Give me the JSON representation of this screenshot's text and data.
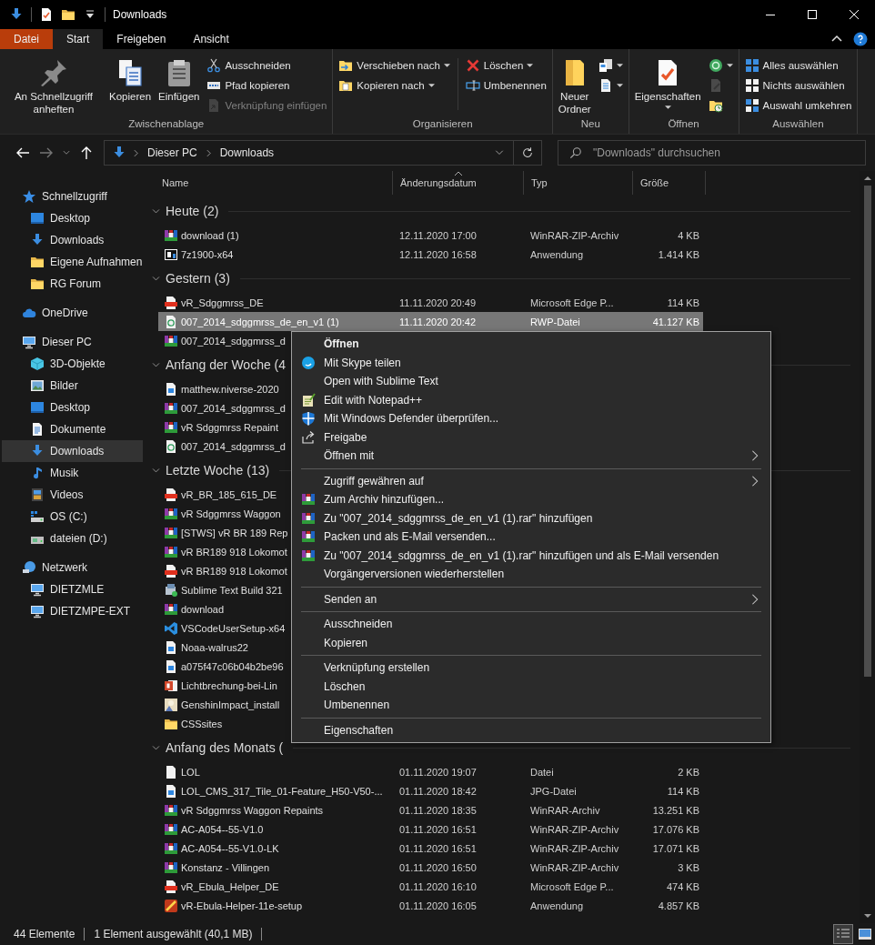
{
  "window": {
    "title": "Downloads"
  },
  "ribbon": {
    "tabs": [
      {
        "label": "Datei",
        "kind": "backstage",
        "selected": false
      },
      {
        "label": "Start",
        "kind": "tab",
        "selected": true
      },
      {
        "label": "Freigeben",
        "kind": "tab",
        "selected": false
      },
      {
        "label": "Ansicht",
        "kind": "tab",
        "selected": false
      }
    ],
    "groups": [
      {
        "title": "Zwischenablage",
        "columns": [
          {
            "kind": "large",
            "items": [
              {
                "label": "An Schnellzugriff anheften",
                "kind": "pin",
                "dropdown": false,
                "disabled": false
              }
            ]
          },
          {
            "kind": "large",
            "items": [
              {
                "label": "Kopieren",
                "kind": "copy",
                "dropdown": false,
                "disabled": false
              }
            ]
          },
          {
            "kind": "large",
            "items": [
              {
                "label": "Einfügen",
                "kind": "paste",
                "dropdown": false,
                "disabled": false
              }
            ]
          },
          {
            "kind": "stack",
            "items": [
              {
                "label": "Ausschneiden",
                "kind": "scissors",
                "dropdown": false,
                "disabled": false
              },
              {
                "label": "Pfad kopieren",
                "kind": "path",
                "dropdown": false,
                "disabled": false
              },
              {
                "label": "Verknüpfung einfügen",
                "kind": "shortcut",
                "dropdown": false,
                "disabled": true
              }
            ]
          }
        ]
      },
      {
        "title": "Organisieren",
        "columns": [
          {
            "kind": "stack",
            "items": [
              {
                "label": "Verschieben nach",
                "kind": "move",
                "dropdown": true,
                "disabled": false
              },
              {
                "label": "Kopieren nach",
                "kind": "copyto",
                "dropdown": true,
                "disabled": false
              }
            ]
          },
          {
            "kind": "stack",
            "items": [
              {
                "label": "Löschen",
                "kind": "delete",
                "dropdown": true,
                "disabled": false
              },
              {
                "label": "Umbenennen",
                "kind": "rename",
                "dropdown": false,
                "disabled": false
              }
            ]
          }
        ]
      },
      {
        "title": "Neu",
        "columns": [
          {
            "kind": "large",
            "items": [
              {
                "label": "Neuer Ordner",
                "kind": "newfolder",
                "dropdown": false,
                "disabled": false
              }
            ]
          },
          {
            "kind": "stack",
            "items": [
              {
                "kind": "newitem",
                "dropdown": true,
                "disabled": false
              },
              {
                "kind": "easyaccess",
                "dropdown": true,
                "disabled": false
              }
            ]
          }
        ]
      },
      {
        "title": "Öffnen",
        "columns": [
          {
            "kind": "large",
            "items": [
              {
                "label": "Eigenschaften",
                "kind": "properties",
                "dropdown": true,
                "disabled": false
              }
            ]
          },
          {
            "kind": "stack",
            "items": [
              {
                "kind": "open",
                "dropdown": true,
                "disabled": false
              },
              {
                "kind": "edit",
                "dropdown": false,
                "disabled": true
              },
              {
                "kind": "history",
                "dropdown": false,
                "disabled": false
              }
            ]
          }
        ]
      },
      {
        "title": "Auswählen",
        "columns": [
          {
            "kind": "stack",
            "items": [
              {
                "label": "Alles auswählen",
                "kind": "selectall",
                "dropdown": false,
                "disabled": false
              },
              {
                "label": "Nichts auswählen",
                "kind": "selectnone",
                "dropdown": false,
                "disabled": false
              },
              {
                "label": "Auswahl umkehren",
                "kind": "invert",
                "dropdown": false,
                "disabled": false
              }
            ]
          }
        ]
      }
    ]
  },
  "navigation": {
    "back": {
      "disabled": false
    },
    "forward": {
      "disabled": true
    }
  },
  "address": {
    "crumbs": [
      "Dieser PC",
      "Downloads"
    ]
  },
  "search": {
    "placeholder": "\"Downloads\" durchsuchen"
  },
  "sidebar": {
    "items": [
      {
        "label": "Schnellzugriff",
        "kind": "star",
        "selected": false,
        "children": [
          {
            "label": "Desktop",
            "kind": "desktop",
            "selected": false
          },
          {
            "label": "Downloads",
            "kind": "download",
            "selected": false
          },
          {
            "label": "Eigene Aufnahmen",
            "kind": "folder",
            "selected": false
          },
          {
            "label": "RG Forum",
            "kind": "folder",
            "selected": false
          }
        ]
      },
      {
        "label": "OneDrive",
        "kind": "cloud",
        "selected": false
      },
      {
        "label": "Dieser PC",
        "kind": "pc",
        "selected": false,
        "children": [
          {
            "label": "3D-Objekte",
            "kind": "cube",
            "selected": false
          },
          {
            "label": "Bilder",
            "kind": "pictures",
            "selected": false
          },
          {
            "label": "Desktop",
            "kind": "desktop",
            "selected": false
          },
          {
            "label": "Dokumente",
            "kind": "documents",
            "selected": false
          },
          {
            "label": "Downloads",
            "kind": "download",
            "selected": true
          },
          {
            "label": "Musik",
            "kind": "music",
            "selected": false
          },
          {
            "label": "Videos",
            "kind": "videos",
            "selected": false
          },
          {
            "label": "OS (C:)",
            "kind": "drive",
            "selected": false
          },
          {
            "label": "dateien (D:)",
            "kind": "netdrive",
            "selected": false
          }
        ]
      },
      {
        "label": "Netzwerk",
        "kind": "network",
        "selected": false,
        "children": [
          {
            "label": "DIETZMLE",
            "kind": "pc",
            "selected": false
          },
          {
            "label": "DIETZMPE-EXT",
            "kind": "pc",
            "selected": false
          }
        ]
      }
    ]
  },
  "columns": [
    {
      "label": "Name",
      "sorted": false
    },
    {
      "label": "Änderungsdatum",
      "sorted": true
    },
    {
      "label": "Typ",
      "sorted": false
    },
    {
      "label": "Größe",
      "sorted": false
    }
  ],
  "groups": [
    {
      "title": "Heute (2)",
      "expanded": true,
      "rows": [
        {
          "name": "download (1)",
          "kind": "rar",
          "date": "12.11.2020 17:00",
          "type": "WinRAR-ZIP-Archiv",
          "size": "4 KB",
          "selected": false
        },
        {
          "name": "7z1900-x64",
          "kind": "sevenzip",
          "date": "12.11.2020 16:58",
          "type": "Anwendung",
          "size": "1.414 KB",
          "selected": false
        }
      ]
    },
    {
      "title": "Gestern (3)",
      "expanded": true,
      "rows": [
        {
          "name": "vR_Sdggmrss_DE",
          "kind": "pdf",
          "date": "11.11.2020 20:49",
          "type": "Microsoft Edge P...",
          "size": "114 KB",
          "selected": false
        },
        {
          "name": "007_2014_sdggmrss_de_en_v1 (1)",
          "kind": "rwp",
          "date": "11.11.2020 20:42",
          "type": "RWP-Datei",
          "size": "41.127 KB",
          "selected": true
        },
        {
          "name": "007_2014_sdggmrss_d",
          "kind": "rar",
          "selected": false
        }
      ]
    },
    {
      "title": "Anfang der Woche (4",
      "expanded": true,
      "rows": [
        {
          "name": "matthew.niverse-2020",
          "kind": "image",
          "selected": false
        },
        {
          "name": "007_2014_sdggmrss_d",
          "kind": "rar",
          "selected": false
        },
        {
          "name": "vR Sdggmrss Repaint",
          "kind": "rar",
          "selected": false
        },
        {
          "name": "007_2014_sdggmrss_d",
          "kind": "rwp",
          "selected": false
        }
      ]
    },
    {
      "title": "Letzte Woche (13)",
      "expanded": true,
      "rows": [
        {
          "name": "vR_BR_185_615_DE",
          "kind": "pdf",
          "selected": false
        },
        {
          "name": "vR Sdggmrss Waggon",
          "kind": "rar",
          "selected": false
        },
        {
          "name": "[STWS] vR BR 189 Rep",
          "kind": "rar",
          "selected": false
        },
        {
          "name": "vR BR189 918 Lokomot",
          "kind": "rar",
          "selected": false
        },
        {
          "name": "vR BR189 918 Lokomot",
          "kind": "pdf",
          "selected": false
        },
        {
          "name": "Sublime Text Build 321",
          "kind": "setup",
          "selected": false
        },
        {
          "name": "download",
          "kind": "rar",
          "selected": false
        },
        {
          "name": "VSCodeUserSetup-x64",
          "kind": "vscode",
          "selected": false
        },
        {
          "name": "Noaa-walrus22",
          "kind": "image",
          "selected": false
        },
        {
          "name": "a075f47c06b04b2be96",
          "kind": "image",
          "selected": false
        },
        {
          "name": "Lichtbrechung-bei-Lin",
          "kind": "ppt",
          "selected": false
        },
        {
          "name": "GenshinImpact_install",
          "kind": "game",
          "selected": false
        },
        {
          "name": "CSSsites",
          "kind": "folder",
          "selected": false
        }
      ]
    },
    {
      "title": "Anfang des Monats (",
      "expanded": true,
      "rows": [
        {
          "name": "LOL",
          "kind": "blank",
          "date": "01.11.2020 19:07",
          "type": "Datei",
          "size": "2 KB",
          "selected": false
        },
        {
          "name": "LOL_CMS_317_Tile_01-Feature_H50-V50-...",
          "kind": "image",
          "date": "01.11.2020 18:42",
          "type": "JPG-Datei",
          "size": "114 KB",
          "selected": false
        },
        {
          "name": "vR Sdggmrss Waggon Repaints",
          "kind": "rar",
          "date": "01.11.2020 18:35",
          "type": "WinRAR-Archiv",
          "size": "13.251 KB",
          "selected": false
        },
        {
          "name": "AC-A054--55-V1.0",
          "kind": "rar",
          "date": "01.11.2020 16:51",
          "type": "WinRAR-ZIP-Archiv",
          "size": "17.076 KB",
          "selected": false
        },
        {
          "name": "AC-A054--55-V1.0-LK",
          "kind": "rar",
          "date": "01.11.2020 16:51",
          "type": "WinRAR-ZIP-Archiv",
          "size": "17.071 KB",
          "selected": false
        },
        {
          "name": "Konstanz - Villingen",
          "kind": "rar",
          "date": "01.11.2020 16:50",
          "type": "WinRAR-ZIP-Archiv",
          "size": "3 KB",
          "selected": false
        },
        {
          "name": "vR_Ebula_Helper_DE",
          "kind": "pdf",
          "date": "01.11.2020 16:10",
          "type": "Microsoft Edge P...",
          "size": "474 KB",
          "selected": false
        },
        {
          "name": "vR-Ebula-Helper-11e-setup",
          "kind": "vr",
          "date": "01.11.2020 16:05",
          "type": "Anwendung",
          "size": "4.857 KB",
          "selected": false
        }
      ]
    }
  ],
  "context_menu": {
    "items": [
      {
        "kind": "plain",
        "label": "Öffnen",
        "bold": true,
        "submenu": false
      },
      {
        "kind": "chat",
        "label": "Mit Skype teilen",
        "bold": false,
        "submenu": false
      },
      {
        "kind": "plain",
        "label": "Open with Sublime Text",
        "bold": false,
        "submenu": false
      },
      {
        "kind": "notepad",
        "label": "Edit with Notepad++",
        "bold": false,
        "submenu": false
      },
      {
        "kind": "shield",
        "label": "Mit Windows Defender überprüfen...",
        "bold": false,
        "submenu": false
      },
      {
        "kind": "share",
        "label": "Freigabe",
        "bold": false,
        "submenu": false
      },
      {
        "kind": "plain",
        "label": "Öffnen mit",
        "bold": false,
        "submenu": true
      },
      {
        "kind": "separator"
      },
      {
        "kind": "plain",
        "label": "Zugriff gewähren auf",
        "bold": false,
        "submenu": true
      },
      {
        "kind": "archive",
        "label": "Zum Archiv hinzufügen...",
        "bold": false,
        "submenu": false
      },
      {
        "kind": "archive",
        "label": "Zu \"007_2014_sdggmrss_de_en_v1 (1).rar\" hinzufügen",
        "bold": false,
        "submenu": false
      },
      {
        "kind": "archive",
        "label": "Packen und als E-Mail versenden...",
        "bold": false,
        "submenu": false
      },
      {
        "kind": "archive",
        "label": "Zu \"007_2014_sdggmrss_de_en_v1 (1).rar\" hinzufügen und als E-Mail versenden",
        "bold": false,
        "submenu": false
      },
      {
        "kind": "plain",
        "label": "Vorgängerversionen wiederherstellen",
        "bold": false,
        "submenu": false
      },
      {
        "kind": "separator"
      },
      {
        "kind": "plain",
        "label": "Senden an",
        "bold": false,
        "submenu": true
      },
      {
        "kind": "separator"
      },
      {
        "kind": "plain",
        "label": "Ausschneiden",
        "bold": false,
        "submenu": false
      },
      {
        "kind": "plain",
        "label": "Kopieren",
        "bold": false,
        "submenu": false
      },
      {
        "kind": "separator"
      },
      {
        "kind": "plain",
        "label": "Verknüpfung erstellen",
        "bold": false,
        "submenu": false
      },
      {
        "kind": "plain",
        "label": "Löschen",
        "bold": false,
        "submenu": false
      },
      {
        "kind": "plain",
        "label": "Umbenennen",
        "bold": false,
        "submenu": false
      },
      {
        "kind": "separator"
      },
      {
        "kind": "plain",
        "label": "Eigenschaften",
        "bold": false,
        "submenu": false
      }
    ]
  },
  "status": {
    "count": "44 Elemente",
    "selection": "1 Element ausgewählt (40,1 MB)",
    "views": [
      {
        "kind": "details",
        "selected": true
      },
      {
        "kind": "tiles",
        "selected": false
      }
    ]
  }
}
